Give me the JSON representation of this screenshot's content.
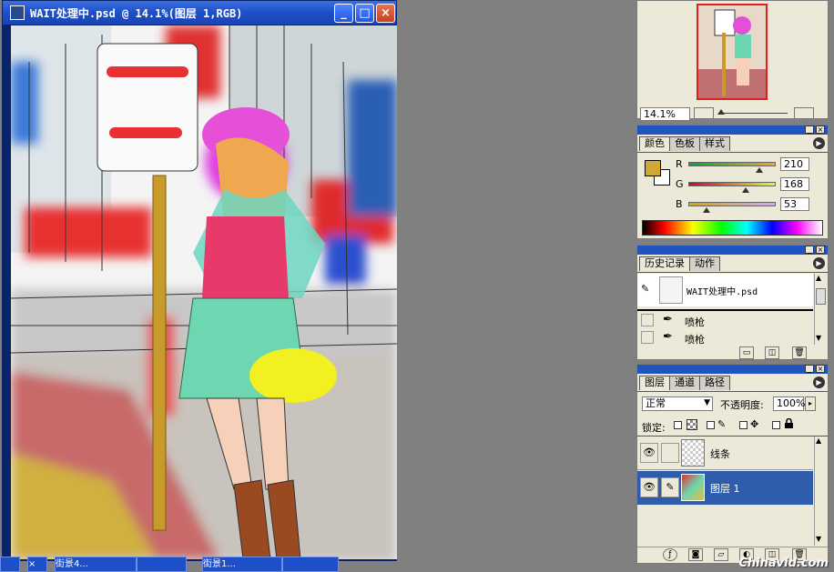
{
  "document": {
    "title": "WAIT处理中.psd @ 14.1%(图层 1,RGB)"
  },
  "taskbar": {
    "items": [
      "",
      "",
      "街景4...",
      "",
      "街景1...",
      "",
      ""
    ]
  },
  "navigator": {
    "zoom_value": "14.1%"
  },
  "color_palette": {
    "tabs": [
      "颜色",
      "色板",
      "样式"
    ],
    "channels": [
      {
        "label": "R",
        "value": "210",
        "fraction": 0.82
      },
      {
        "label": "G",
        "value": "168",
        "fraction": 0.66
      },
      {
        "label": "B",
        "value": "53",
        "fraction": 0.21
      }
    ],
    "foreground_color": "#d2a835"
  },
  "history_palette": {
    "tabs": [
      "历史记录",
      "动作"
    ],
    "snapshot_label": "WAIT处理中.psd",
    "steps": [
      "喷枪",
      "喷枪"
    ]
  },
  "layers_palette": {
    "tabs": [
      "图层",
      "通道",
      "路径"
    ],
    "blend_mode": "正常",
    "opacity_label": "不透明度:",
    "opacity_value": "100%",
    "lock_label": "锁定:",
    "layers": [
      {
        "name": "线条",
        "visible": true,
        "selected": false
      },
      {
        "name": "图层 1",
        "visible": true,
        "selected": true
      }
    ]
  },
  "watermark": "Chinavid.com"
}
